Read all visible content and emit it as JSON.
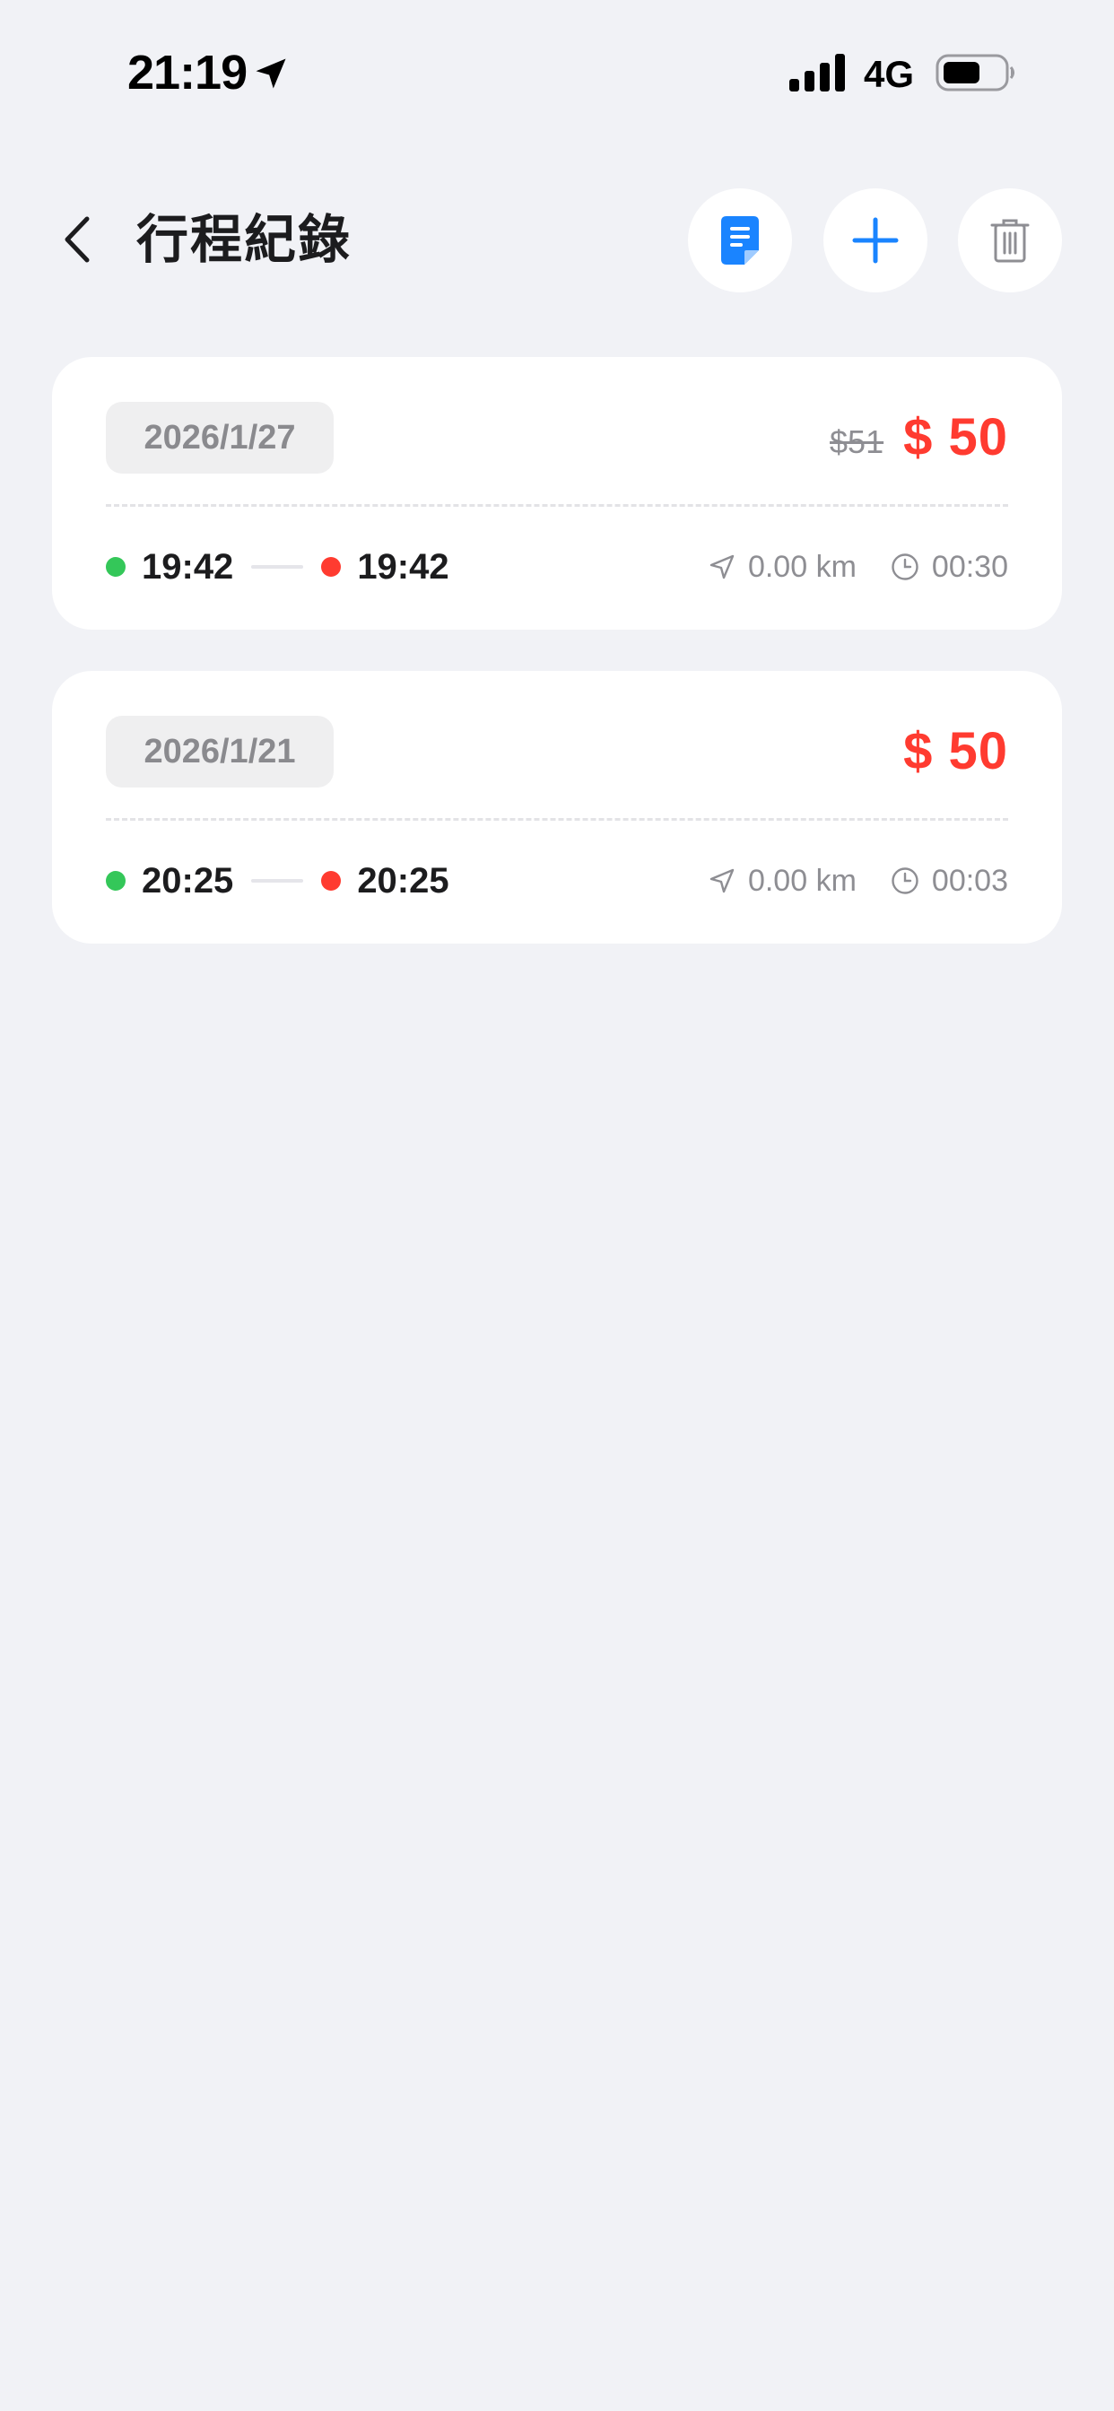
{
  "status_bar": {
    "time": "21:19",
    "network": "4G",
    "icons": [
      "location-arrow-icon",
      "signal-icon",
      "battery-icon"
    ]
  },
  "header": {
    "title": "行程紀錄",
    "back_icon": "chevron-left-icon",
    "actions": [
      {
        "name": "report-button",
        "icon": "document-icon",
        "color": "#1a84ff"
      },
      {
        "name": "add-button",
        "icon": "plus-icon",
        "color": "#1a84ff"
      },
      {
        "name": "delete-button",
        "icon": "trash-icon",
        "color": "#8e8e93"
      }
    ]
  },
  "trips": [
    {
      "date": "2026/1/27",
      "original_price": "$51",
      "price": "$ 50",
      "start_time": "19:42",
      "end_time": "19:42",
      "distance": "0.00 km",
      "duration": "00:30"
    },
    {
      "date": "2026/1/21",
      "original_price": "",
      "price": "$ 50",
      "start_time": "20:25",
      "end_time": "20:25",
      "distance": "0.00 km",
      "duration": "00:03"
    }
  ],
  "colors": {
    "background": "#f1f2f6",
    "accent": "#1a84ff",
    "price": "#ff3b30",
    "start_dot": "#34c759",
    "end_dot": "#ff3b30"
  }
}
